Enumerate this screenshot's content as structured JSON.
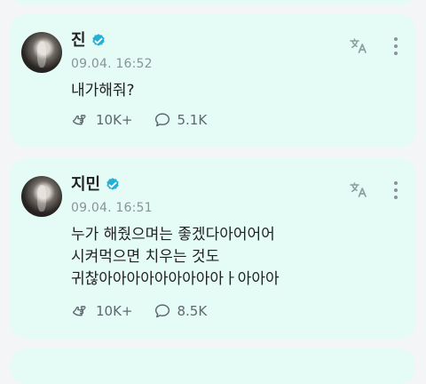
{
  "colors": {
    "card": "#e5fbf5",
    "verified": "#23b0d6",
    "meta": "#8a9399",
    "icon": "#8aa2a5"
  },
  "posts": [
    {
      "author": "진",
      "timestamp": "09.04. 16:52",
      "lines": [
        "내가해줘?"
      ],
      "likes": "10K+",
      "comments": "5.1K"
    },
    {
      "author": "지민",
      "timestamp": "09.04. 16:51",
      "lines": [
        "누가 해줬으며는 좋겠다아어어어",
        "시켜먹으면 치우는 것도",
        "귀찮아아아아아아아아아ㅏ아아아"
      ],
      "likes": "10K+",
      "comments": "8.5K"
    }
  ]
}
